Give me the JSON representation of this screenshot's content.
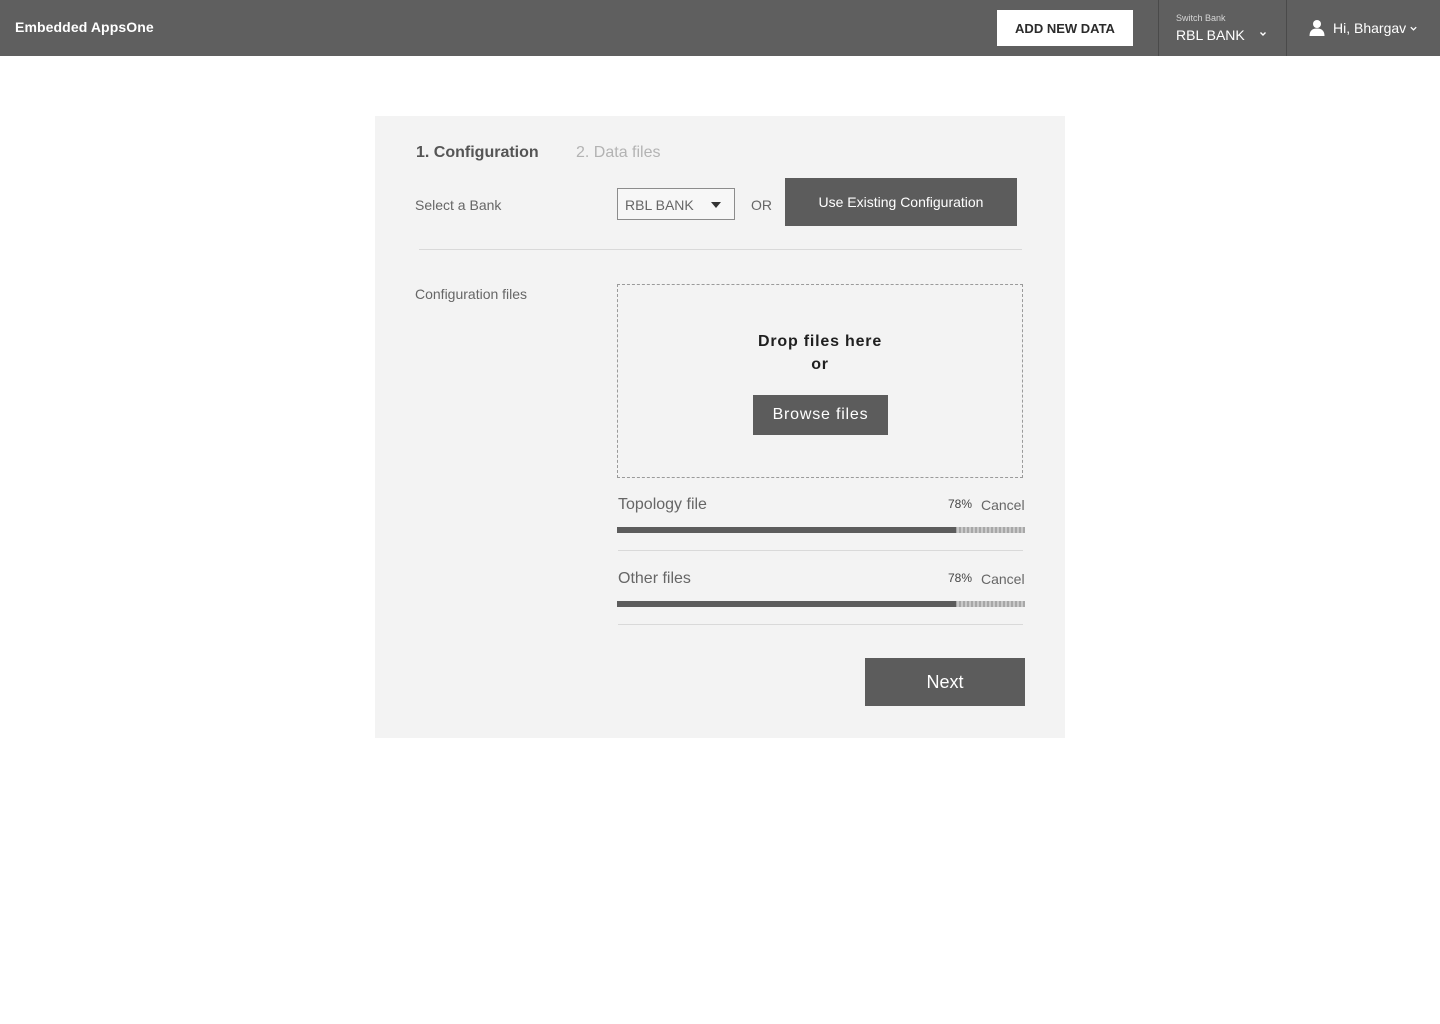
{
  "header": {
    "app_title": "Embedded AppsOne",
    "add_new_data_label": "ADD NEW DATA",
    "switch_bank": {
      "label": "Switch Bank",
      "value": "RBL BANK"
    },
    "user_greeting": "Hi, Bhargav"
  },
  "steps": [
    {
      "label": "1. Configuration",
      "active": true
    },
    {
      "label": "2. Data files",
      "active": false
    }
  ],
  "bank_select": {
    "label": "Select a Bank",
    "value": "RBL BANK",
    "or_text": "OR",
    "existing_config_label": "Use Existing Configuration"
  },
  "config_files": {
    "label": "Configuration files",
    "drop_title": "Drop files here",
    "drop_or": "or",
    "browse_label": "Browse files"
  },
  "uploads": [
    {
      "name": "Topology file",
      "progress": 0.83,
      "percent_text": "78%",
      "cancel_label": "Cancel"
    },
    {
      "name": "Other files",
      "progress": 0.83,
      "percent_text": "78%",
      "cancel_label": "Cancel"
    }
  ],
  "next_label": "Next",
  "icons": {
    "user": "user-icon",
    "chevron": "chevron-down-icon",
    "caret": "caret-down-icon"
  }
}
